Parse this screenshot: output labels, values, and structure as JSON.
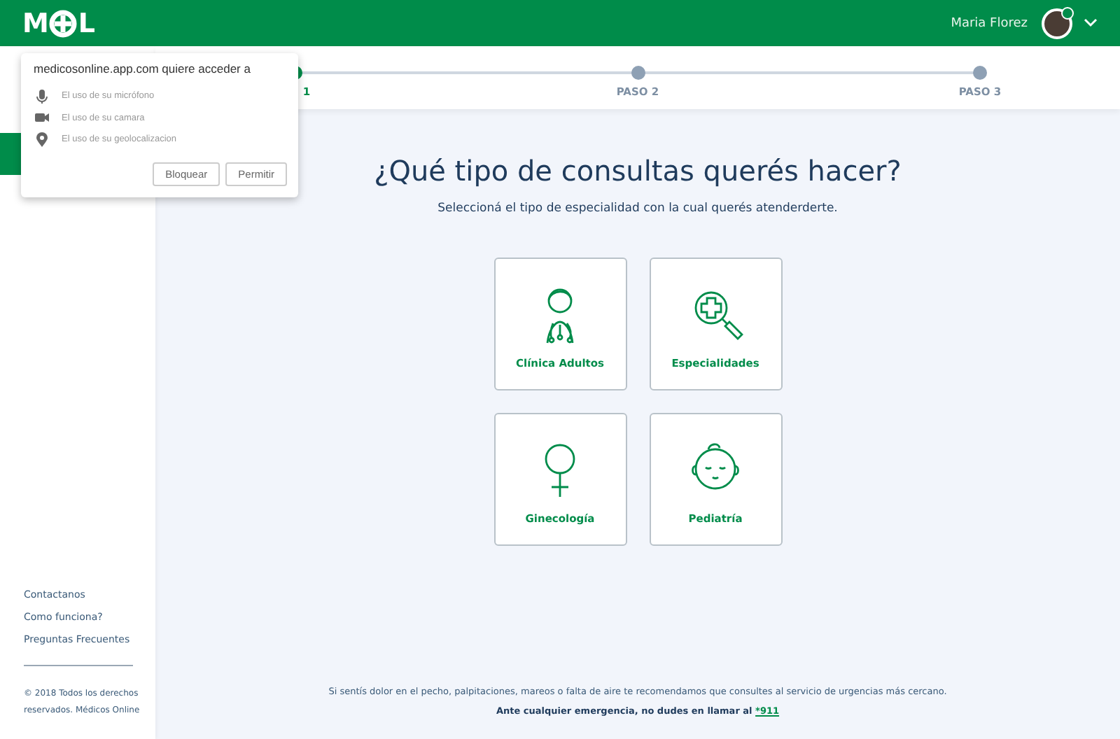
{
  "header": {
    "logo": {
      "left": "M",
      "right": "L"
    },
    "user_name": "Maria Florez",
    "online": true
  },
  "sidebar": {
    "items": [
      {
        "label": "Contactanos"
      },
      {
        "label": "Como funciona?"
      },
      {
        "label": "Preguntas Frecuentes"
      }
    ],
    "copyright": "© 2018 Todos los derechos reservados. Médicos Online"
  },
  "steps": [
    {
      "label": "1",
      "selected": true
    },
    {
      "label": "PASO 2",
      "selected": false
    },
    {
      "label": "PASO 3",
      "selected": false
    }
  ],
  "title": "¿Qué tipo de consultas querés hacer?",
  "subtitle": "Seleccioná el tipo de especialidad con la cual querés atenderderte.",
  "options": [
    {
      "kind": "doctor",
      "label": "Clínica Adultos"
    },
    {
      "kind": "search",
      "label": "Especialidades"
    },
    {
      "kind": "female",
      "label": "Ginecología"
    },
    {
      "kind": "baby",
      "label": "Pediatría"
    }
  ],
  "notice": "Si sentís dolor en el pecho, palpitaciones, mareos o falta de aire te recomendamos que consultes al servicio de urgencias más cercano.",
  "emergency": {
    "text": "Ante cualquier emergencia, no dudes en llamar al",
    "link": "*911"
  },
  "permission_popup": {
    "title": "medicosonline.app.com quiere acceder a",
    "items": [
      {
        "kind": "mic",
        "label": "El uso de su micrófono"
      },
      {
        "kind": "camera",
        "label": "El uso de su camara"
      },
      {
        "kind": "location",
        "label": "El uso de su geolocalizacion"
      }
    ],
    "buttons": [
      "Bloquear",
      "Permitir"
    ]
  }
}
